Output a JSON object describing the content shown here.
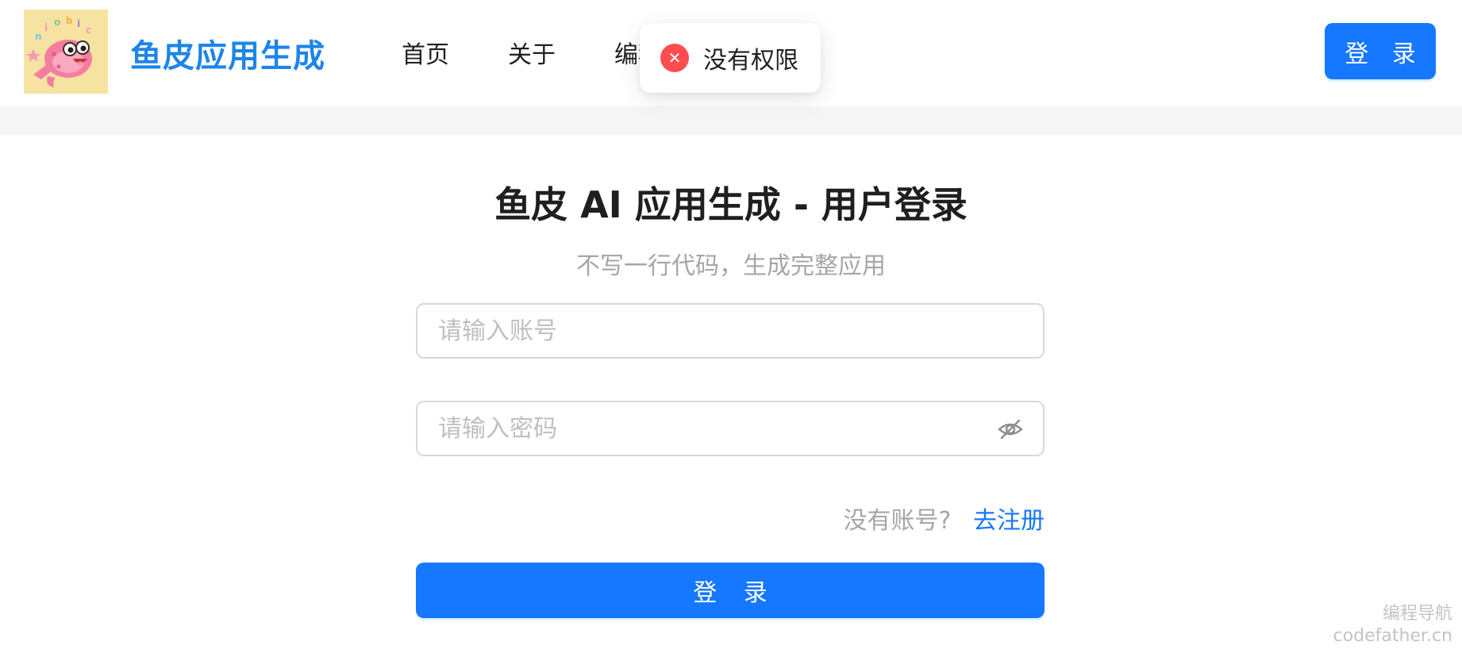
{
  "header": {
    "brand": "鱼皮应用生成",
    "nav": [
      "首页",
      "关于",
      "编程导航"
    ],
    "login_label": "登 录"
  },
  "toast": {
    "message": "没有权限"
  },
  "form": {
    "title": "鱼皮 AI 应用生成 - 用户登录",
    "subtitle": "不写一行代码，生成完整应用",
    "account_placeholder": "请输入账号",
    "password_placeholder": "请输入密码",
    "register_prompt": "没有账号?",
    "register_link": "去注册",
    "submit_label": "登 录"
  },
  "watermark": {
    "line1": "编程导航",
    "line2": "codefather.cn"
  },
  "colors": {
    "brand": "#1d85e8",
    "primary": "#1677ff",
    "error": "#ff4d4f"
  },
  "icons": {
    "toast": "error-circle-icon",
    "password_toggle": "eye-invisible-icon"
  }
}
